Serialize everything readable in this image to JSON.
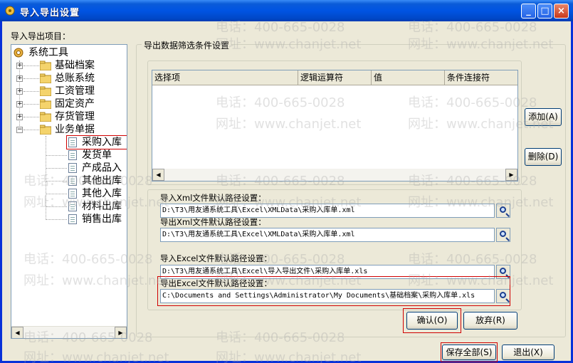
{
  "window": {
    "title": "导入导出设置"
  },
  "titlebar_buttons": {
    "minimize": "_",
    "maximize": "□",
    "close": "×"
  },
  "left": {
    "label": "导入导出项目：",
    "tree": {
      "root": "系统工具",
      "folders": [
        "基础档案",
        "总账系统",
        "工资管理",
        "固定资产",
        "存货管理",
        "业务单据"
      ],
      "documents": [
        "采购入库",
        "发货单",
        "产成品入",
        "其他出库",
        "其他入库",
        "材料出库",
        "销售出库"
      ],
      "selected": "采购入库"
    }
  },
  "filter": {
    "group_title": "导出数据筛选条件设置",
    "columns": [
      "选择项",
      "逻辑运算符",
      "值",
      "条件连接符"
    ],
    "add_button": "添加(A)",
    "delete_button": "删除(D)"
  },
  "paths": {
    "import_xml_label": "导入Xml文件默认路径设置：",
    "import_xml_value": "D:\\T3\\用友通系统工具\\Excel\\XMLData\\采购入库单.xml",
    "export_xml_label": "导出Xml文件默认路径设置：",
    "export_xml_value": "D:\\T3\\用友通系统工具\\Excel\\XMLData\\采购入库单.xml",
    "import_excel_label": "导入Excel文件默认路径设置：",
    "import_excel_value": "D:\\T3\\用友通系统工具\\Excel\\导入导出文件\\采购入库单.xls",
    "export_excel_label": "导出Excel文件默认路径设置：",
    "export_excel_value": "C:\\Documents and Settings\\Administrator\\My Documents\\基础档案\\采购入库单.xls"
  },
  "buttons": {
    "confirm": "确认(O)",
    "cancel": "放弃(R)",
    "save_all": "保存全部(S)",
    "exit": "退出(X)"
  },
  "watermarks": {
    "phone": "电话：400-665-0028",
    "site": "网址：www.chanjet.net"
  },
  "colors": {
    "titlebar": "#0054e3",
    "highlight_box": "#d00000",
    "window_bg": "#ece9d8"
  }
}
